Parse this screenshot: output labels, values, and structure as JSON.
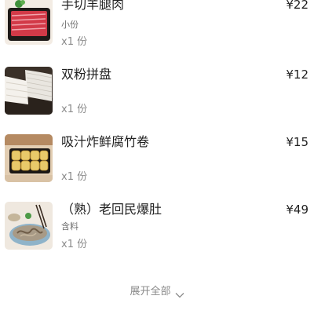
{
  "order_items": [
    {
      "name": "手切羊腿肉",
      "spec": "小份",
      "quantity": "x1 份",
      "price": "¥22",
      "image_icon": "sliced-lamb-leg-image"
    },
    {
      "name": "双粉拼盘",
      "spec": "",
      "quantity": "x1 份",
      "price": "¥12",
      "image_icon": "noodle-platter-image"
    },
    {
      "name": "吸汁炸鲜腐竹卷",
      "spec": "",
      "quantity": "x1 份",
      "price": "¥15",
      "image_icon": "tofu-skin-roll-image"
    },
    {
      "name": "（熟）老回民爆肚",
      "spec": "含料",
      "quantity": "x1 份",
      "price": "¥49",
      "image_icon": "tripe-dish-image"
    }
  ],
  "expand_all": {
    "label": "展开全部",
    "icon": "chevron-down-icon"
  }
}
